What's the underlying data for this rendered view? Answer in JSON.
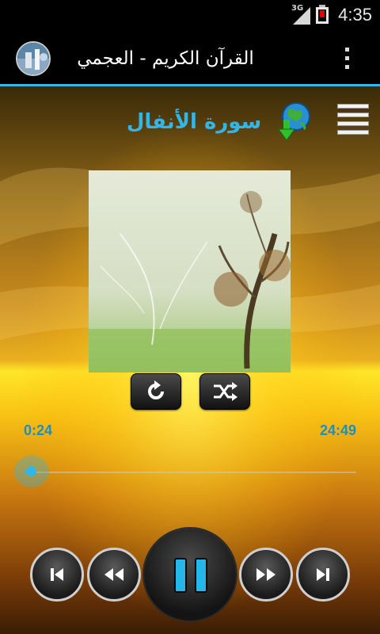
{
  "status_bar": {
    "network": "3G",
    "time": "4:35"
  },
  "app": {
    "title": "القرآن الكريم - العجمي",
    "icon": "app-logo-icon",
    "menu_icon": "overflow-menu-icon"
  },
  "player": {
    "surah_name": "سورة الأنفال",
    "download_icon": "globe-download-icon",
    "menu_icon": "hamburger-menu-icon",
    "artwork": "tree-artwork",
    "elapsed": "0:24",
    "duration": "24:49",
    "progress": 0.016,
    "repeat_icon": "repeat-icon",
    "shuffle_icon": "shuffle-icon",
    "controls": [
      "skip-previous-icon",
      "rewind-icon",
      "pause-icon",
      "fast-forward-icon",
      "skip-next-icon"
    ]
  },
  "colors": {
    "accent": "#33b5e5",
    "time_text": "#1f8fbf"
  }
}
